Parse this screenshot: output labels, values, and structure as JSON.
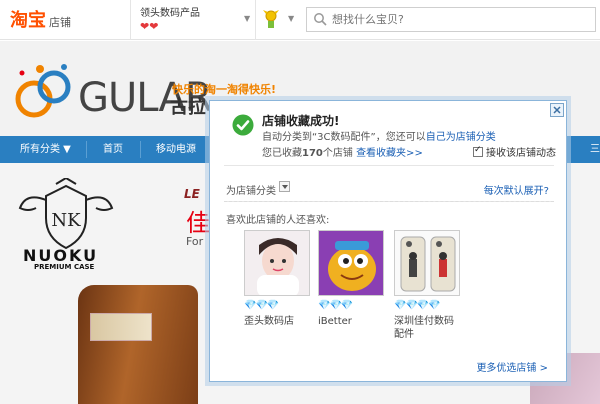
{
  "topbar": {
    "logo": "淘宝",
    "logo_sub": "店铺",
    "shop_name": "领头数码产品",
    "hearts": "❤❤",
    "search_placeholder": "想找什么宝贝?"
  },
  "banner": {
    "brand": "GULAR",
    "slogan": "快乐的淘一淘得快乐!",
    "brand_cn": "古拉"
  },
  "nav": {
    "items": [
      "所有分类 ▼",
      "首页",
      "移动电源",
      "三"
    ]
  },
  "product": {
    "logo_text": "NUOKU",
    "premium": "PREMIUM CASE",
    "le_text": "LE",
    "red_char": "佳",
    "for_text": "For"
  },
  "dialog": {
    "title": "店铺收藏成功!",
    "line1_prefix": "自动分类到“3C数码配件”，您还可以",
    "line1_link": "自己为店铺分类",
    "line2_prefix": "您已收藏",
    "line2_count": "170",
    "line2_suffix": "个店铺",
    "line2_link": "查看收藏夹>>",
    "checkbox_label": "接收该店铺动态",
    "category_label": "为店铺分类",
    "auto_expand_link": "每次默认展开?",
    "like_label": "喜欢此店铺的人还喜欢:",
    "recommendations": [
      {
        "diamonds": "💎💎💎",
        "name": "歪头数码店"
      },
      {
        "diamonds": "💎💎💎",
        "name": "iBetter"
      },
      {
        "diamonds": "💎💎💎💎",
        "name": "深圳佳付数码配件"
      }
    ],
    "more_link": "更多优选店铺 >"
  },
  "colors": {
    "taobao_orange": "#ff5000",
    "nav_blue": "#2a7fc1",
    "link_blue": "#1a5fb4",
    "success_green": "#3cab3c",
    "dialog_border": "#8bb5da"
  }
}
